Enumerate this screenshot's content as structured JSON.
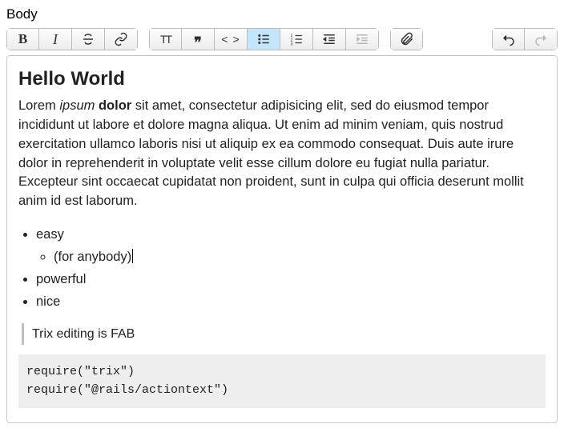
{
  "field_label": "Body",
  "toolbar": {
    "bold_glyph": "B",
    "italic_glyph": "I",
    "heading_glyph": "TT",
    "quote_glyph": "❞",
    "code_glyph": "< >"
  },
  "content": {
    "heading": "Hello World",
    "para_prefix": "Lorem ",
    "para_em": "ipsum",
    "para_gap": " ",
    "para_strong": "dolor",
    "para_rest": " sit amet, consectetur adipisicing elit, sed do eiusmod tempor incididunt ut labore et dolore magna aliqua. Ut enim ad minim veniam, quis nostrud exercitation ullamco laboris nisi ut aliquip ex ea commodo consequat. Duis aute irure dolor in reprehenderit in voluptate velit esse cillum dolore eu fugiat nulla pariatur. Excepteur sint occaecat cupidatat non proident, sunt in culpa qui officia deserunt mollit anim id est laborum.",
    "list": {
      "i0": "easy",
      "i0_0": "(for anybody)",
      "i1": "powerful",
      "i2": "nice"
    },
    "quote": "Trix editing is FAB",
    "code": "require(\"trix\")\nrequire(\"@rails/actiontext\")"
  }
}
